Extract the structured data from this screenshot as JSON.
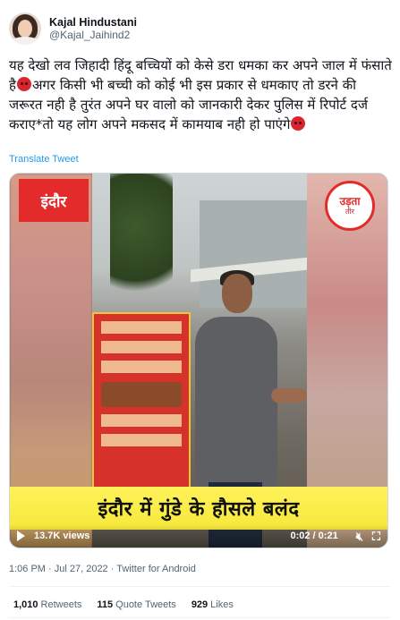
{
  "author": {
    "display_name": "Kajal Hindustani",
    "handle": "@Kajal_Jaihind2"
  },
  "tweet": {
    "text_part1": "यह देखो लव जिहादी हिंदू बच्चियों को केसे डरा धमका कर अपने जाल में फंसाते है",
    "text_part2": "अगर किसी भी बच्ची को कोई भी इस प्रकार से धमकाए तो डरने की जरूरत नही है तुरंत अपने घर वालो को जानकारी देकर पुलिस में रिपोर्ट दर्ज कराए*तो यह लोग अपने मकसद में कामयाब नही हो पाएंगे",
    "emoji_icon": "angry-face-emoji",
    "translate_label": "Translate Tweet"
  },
  "video": {
    "location_tag": "इंदौर",
    "channel_logo_text": "उड़ता",
    "channel_logo_subtext": "तीर",
    "headline_banner": "इंदौर में गुंडे के हौसले बलंद",
    "views": "13.7K views",
    "time": "0:02 / 0:21",
    "mute_icon": "muted-speaker-icon",
    "fullscreen_icon": "fullscreen-icon",
    "play_icon": "play-icon"
  },
  "meta": {
    "timestamp": "1:06 PM · Jul 27, 2022 · Twitter for Android"
  },
  "stats": {
    "retweets_count": "1,010",
    "retweets_label": "Retweets",
    "quotes_count": "115",
    "quotes_label": "Quote Tweets",
    "likes_count": "929",
    "likes_label": "Likes"
  },
  "colors": {
    "accent_link": "#1d9bf0",
    "tag_red": "#e32b2b",
    "banner_yellow": "#f6e83a"
  }
}
